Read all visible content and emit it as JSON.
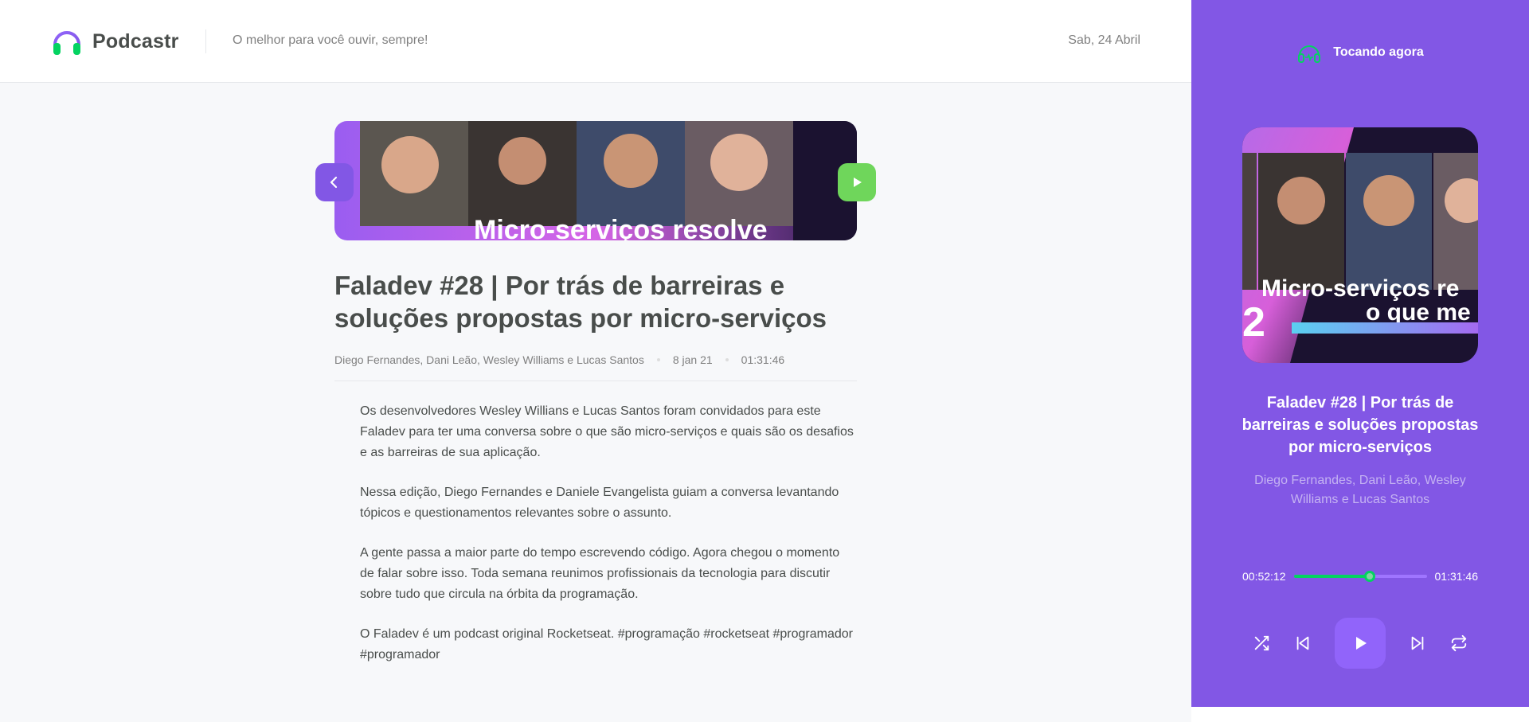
{
  "header": {
    "app_name": "Podcastr",
    "tagline": "O melhor para você ouvir, sempre!",
    "date": "Sab, 24 Abril"
  },
  "episode": {
    "thumbnail_caption": "Micro-serviços resolve",
    "title": "Faladev #28 | Por trás de barreiras e soluções propostas por micro-serviços",
    "members": "Diego Fernandes, Dani Leão, Wesley Williams e Lucas Santos",
    "published_at": "8 jan 21",
    "duration": "01:31:46",
    "description": [
      "Os desenvolvedores Wesley Willians e Lucas Santos foram convidados para este Faladev para ter uma conversa sobre o que são micro-serviços e quais são os desafios e as barreiras de sua aplicação.",
      "Nessa edição, Diego Fernandes e Daniele Evangelista guiam a conversa levantando tópicos e questionamentos relevantes sobre o assunto.",
      "A gente passa a maior parte do tempo escrevendo código. Agora chegou o momento de falar sobre isso. Toda semana reunimos profissionais da tecnologia para discutir sobre tudo que circula na órbita da programação.",
      "O Faladev é um podcast original Rocketseat.  #programação #rocketseat #programador #programador"
    ]
  },
  "player": {
    "header_label": "Tocando agora",
    "cover_caption_line1": "Micro-serviços re",
    "cover_caption_line2": "o que me",
    "cover_number": "2",
    "title": "Faladev #28 | Por trás de barreiras e soluções propostas por micro-serviços",
    "members": "Diego Fernandes, Dani Leão, Wesley Williams e Lucas Santos",
    "current_time": "00:52:12",
    "total_time": "01:31:46",
    "progress": 0.57
  },
  "icons": {
    "logo": "headphones-icon",
    "back": "chevron-left-icon",
    "play": "play-icon",
    "now_playing": "headphones-pulse-icon",
    "shuffle": "shuffle-icon",
    "previous": "skip-back-icon",
    "next": "skip-forward-icon",
    "repeat": "repeat-icon"
  },
  "colors": {
    "purple": "#8257E5",
    "green": "#04D361",
    "text": "#494D4B"
  }
}
